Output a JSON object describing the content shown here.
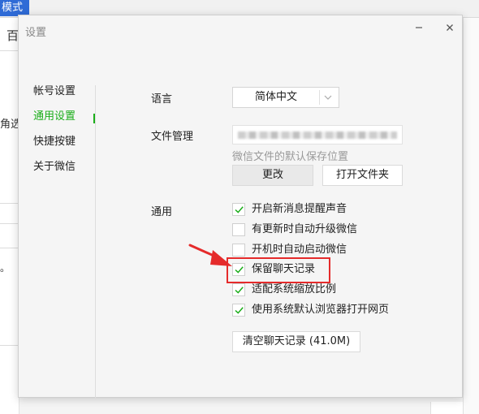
{
  "background": {
    "mode_tab": "模式",
    "left_text_1": "百",
    "left_text_2": "角选",
    "left_text_3": "。"
  },
  "dialog": {
    "title": "设置"
  },
  "sidebar": {
    "items": [
      {
        "label": "帐号设置",
        "active": false
      },
      {
        "label": "通用设置",
        "active": true
      },
      {
        "label": "快捷按键",
        "active": false
      },
      {
        "label": "关于微信",
        "active": false
      }
    ]
  },
  "language": {
    "label": "语言",
    "value": "简体中文"
  },
  "file_management": {
    "label": "文件管理",
    "hint": "微信文件的默认保存位置",
    "change_button": "更改",
    "open_button": "打开文件夹"
  },
  "general": {
    "label": "通用",
    "options": [
      {
        "label": "开启新消息提醒声音",
        "checked": true
      },
      {
        "label": "有更新时自动升级微信",
        "checked": false
      },
      {
        "label": "开机时自动启动微信",
        "checked": false
      },
      {
        "label": "保留聊天记录",
        "checked": true
      },
      {
        "label": "适配系统缩放比例",
        "checked": true
      },
      {
        "label": "使用系统默认浏览器打开网页",
        "checked": true
      }
    ],
    "clear_button": "清空聊天记录 (41.0M)"
  },
  "colors": {
    "accent": "#1aad19",
    "highlight": "#e52b2b"
  }
}
